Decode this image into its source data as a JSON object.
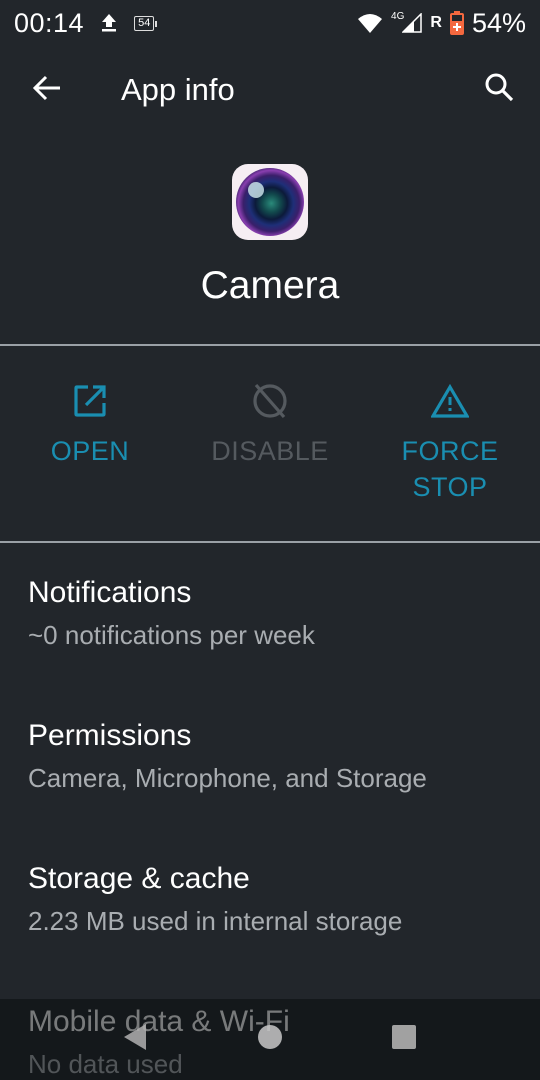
{
  "status_bar": {
    "time": "00:14",
    "notification_badge": "54",
    "network_type": "4G",
    "roaming": "R",
    "battery_percent": "54%",
    "icons": [
      "upload-icon",
      "notification-count-icon",
      "wifi-icon",
      "cellular-signal-icon",
      "battery-saver-icon"
    ],
    "battery_color": "#f4683f"
  },
  "app_bar": {
    "title": "App info",
    "back_icon": "arrow-back-icon",
    "search_icon": "search-icon"
  },
  "app": {
    "name": "Camera",
    "icon": "camera-lens-icon"
  },
  "actions": [
    {
      "label": "OPEN",
      "icon": "open-external-icon",
      "enabled": true
    },
    {
      "label": "DISABLE",
      "icon": "disable-icon",
      "enabled": false
    },
    {
      "label": "FORCE STOP",
      "icon": "warning-icon",
      "enabled": true
    }
  ],
  "accent_color": "#1a8eb1",
  "preferences": [
    {
      "title": "Notifications",
      "summary": "~0 notifications per week"
    },
    {
      "title": "Permissions",
      "summary": "Camera, Microphone, and Storage"
    },
    {
      "title": "Storage & cache",
      "summary": "2.23 MB used in internal storage"
    },
    {
      "title": "Mobile data & Wi-Fi",
      "summary": "No data used"
    }
  ],
  "nav_bar": {
    "back": "nav-back-icon",
    "home": "nav-home-icon",
    "recents": "nav-recents-icon"
  }
}
